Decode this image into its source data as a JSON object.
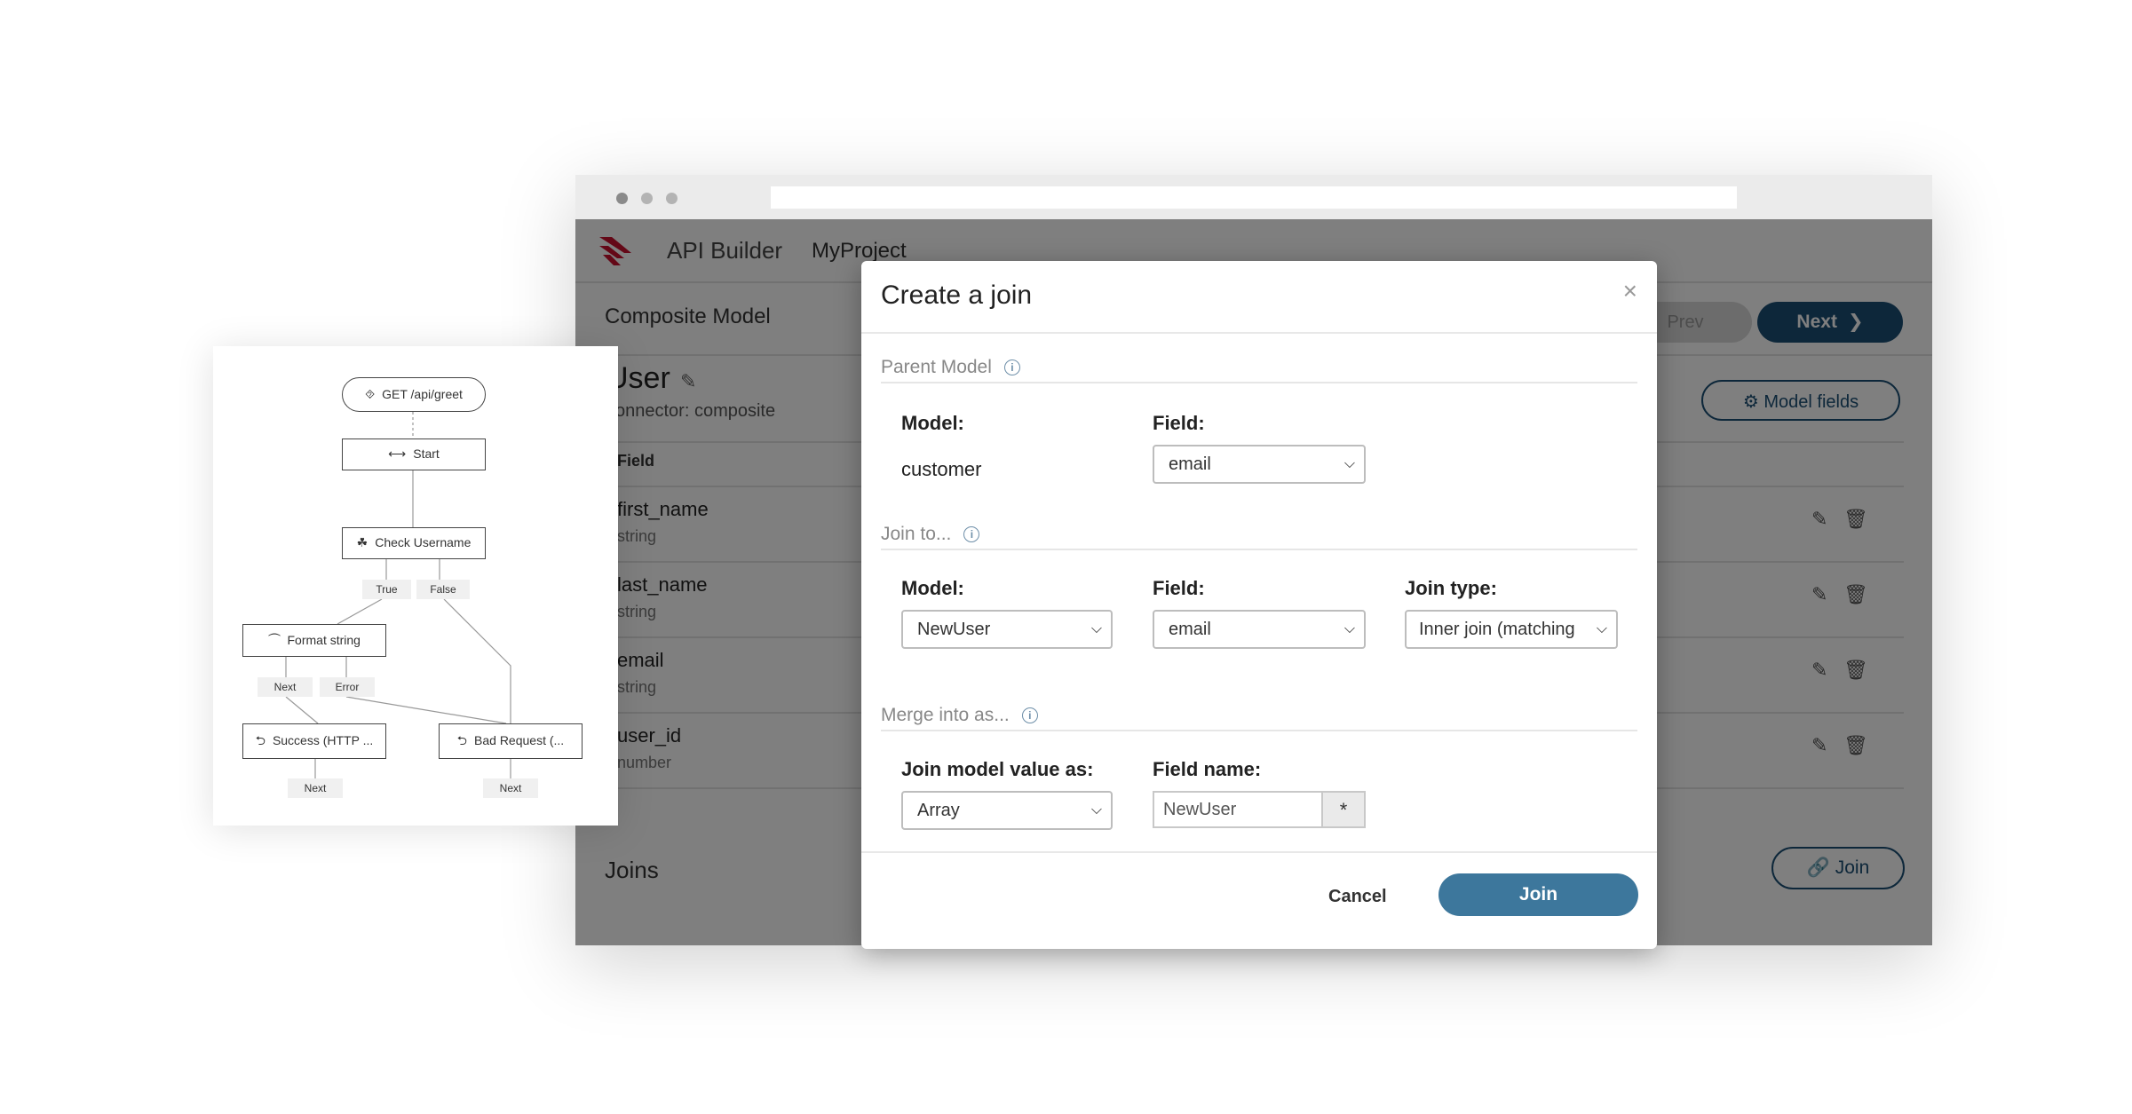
{
  "app": {
    "title": "API Builder",
    "project": "MyProject"
  },
  "page": {
    "title": "Composite Model",
    "prev_label": "Prev",
    "next_label": "Next",
    "model_name": "User",
    "connector_label": "connector:",
    "connector_value": "composite",
    "model_fields_label": "Model fields",
    "column_field": "Field",
    "rows": [
      {
        "name": "first_name",
        "type": "string"
      },
      {
        "name": "last_name",
        "type": "string"
      },
      {
        "name": "email",
        "type": "string"
      },
      {
        "name": "user_id",
        "type": "number"
      }
    ],
    "joins_label": "Joins",
    "join_button_label": "Join"
  },
  "modal": {
    "title": "Create a join",
    "close": "×",
    "parent_section": "Parent Model",
    "parent_model_label": "Model:",
    "parent_model_value": "customer",
    "parent_field_label": "Field:",
    "parent_field_value": "email",
    "join_section": "Join to...",
    "join_model_label": "Model:",
    "join_model_value": "NewUser",
    "join_field_label": "Field:",
    "join_field_value": "email",
    "join_type_label": "Join type:",
    "join_type_value": "Inner join (matching",
    "merge_section": "Merge into as...",
    "join_value_as_label": "Join model value as:",
    "join_value_as_value": "Array",
    "field_name_label": "Field name:",
    "field_name_value": "NewUser",
    "field_name_addon": "*",
    "cancel_label": "Cancel",
    "join_label": "Join"
  },
  "flow": {
    "nodes": {
      "endpoint": "GET /api/greet",
      "start": "Start",
      "check": "Check Username",
      "format": "Format string",
      "success": "Success (HTTP ...",
      "bad": "Bad Request (..."
    },
    "labels": {
      "true": "True",
      "false": "False",
      "next1": "Next",
      "error": "Error",
      "next2": "Next",
      "next3": "Next"
    }
  },
  "colors": {
    "primary": "#1b4f75",
    "join_button": "#3d779c",
    "logo": "#c8102e"
  }
}
